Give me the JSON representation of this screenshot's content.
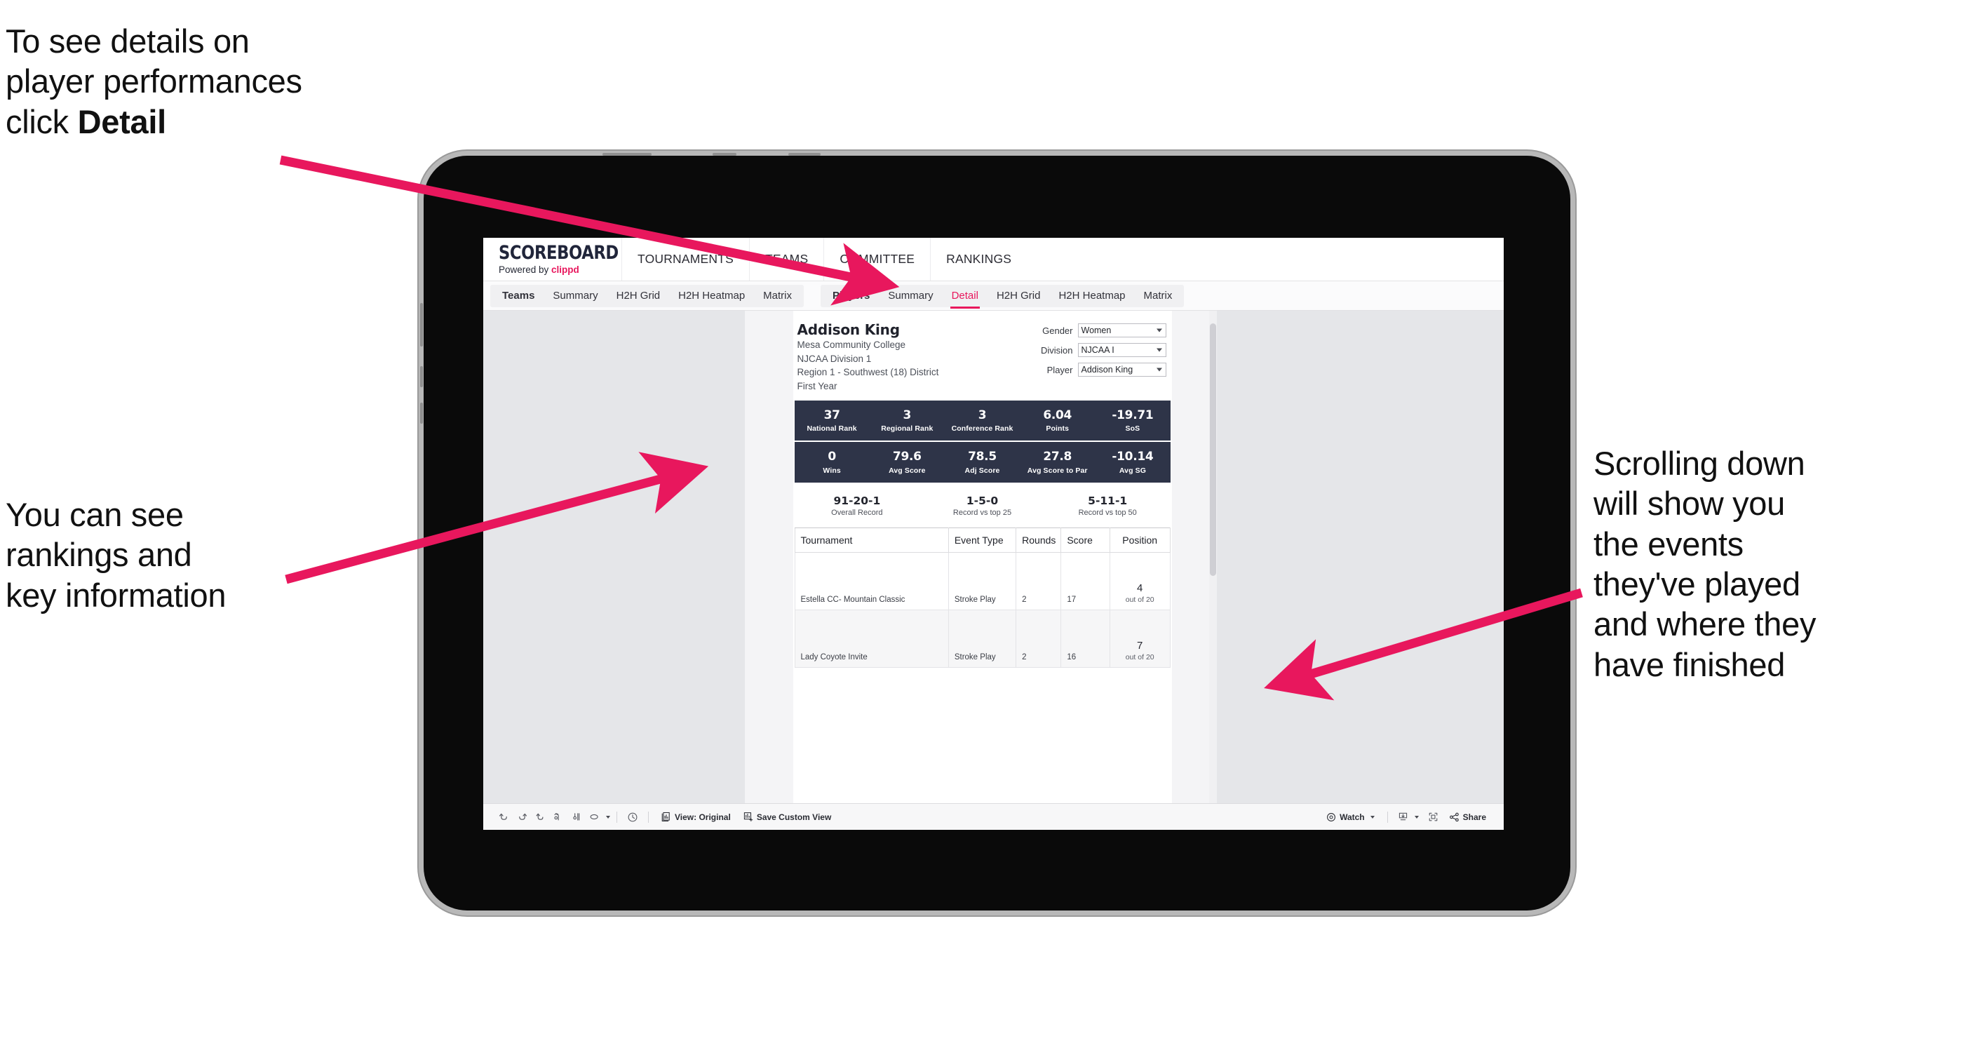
{
  "annotations": {
    "top_left": "To see details on\nplayer performances\nclick ",
    "top_left_bold": "Detail",
    "mid_left": "You can see\nrankings and\nkey information",
    "right": "Scrolling down\nwill show you\nthe events\nthey've played\nand where they\nhave finished"
  },
  "colors": {
    "accent_pink": "#e8175d",
    "band_navy": "#2e3448",
    "arrow_pink": "#e8175d"
  },
  "app": {
    "logo": {
      "title": "SCOREBOARD",
      "powered_prefix": "Powered by ",
      "brand": "clippd"
    },
    "top_nav": [
      "TOURNAMENTS",
      "TEAMS",
      "COMMITTEE",
      "RANKINGS"
    ],
    "tab_groups": [
      {
        "label": "Teams",
        "tabs": [
          "Summary",
          "H2H Grid",
          "H2H Heatmap",
          "Matrix"
        ],
        "active": null
      },
      {
        "label": "Players",
        "tabs": [
          "Summary",
          "Detail",
          "H2H Grid",
          "H2H Heatmap",
          "Matrix"
        ],
        "active": "Detail"
      }
    ]
  },
  "player": {
    "name": "Addison King",
    "school": "Mesa Community College",
    "division": "NJCAA Division 1",
    "region": "Region 1 - Southwest (18) District",
    "year": "First Year"
  },
  "filters": [
    {
      "label": "Gender",
      "value": "Women"
    },
    {
      "label": "Division",
      "value": "NJCAA I"
    },
    {
      "label": "Player",
      "value": "Addison King"
    }
  ],
  "stats_band_1": [
    {
      "value": "37",
      "label": "National Rank"
    },
    {
      "value": "3",
      "label": "Regional Rank"
    },
    {
      "value": "3",
      "label": "Conference Rank"
    },
    {
      "value": "6.04",
      "label": "Points"
    },
    {
      "value": "-19.71",
      "label": "SoS"
    }
  ],
  "stats_band_2": [
    {
      "value": "0",
      "label": "Wins"
    },
    {
      "value": "79.6",
      "label": "Avg Score"
    },
    {
      "value": "78.5",
      "label": "Adj Score"
    },
    {
      "value": "27.8",
      "label": "Avg Score to Par"
    },
    {
      "value": "-10.14",
      "label": "Avg SG"
    }
  ],
  "records": [
    {
      "value": "91-20-1",
      "label": "Overall Record"
    },
    {
      "value": "1-5-0",
      "label": "Record vs top 25"
    },
    {
      "value": "5-11-1",
      "label": "Record vs top 50"
    }
  ],
  "table": {
    "headers": [
      "Tournament",
      "Event Type",
      "Rounds",
      "Score",
      "Position"
    ],
    "rows": [
      {
        "tournament": "Estella CC- Mountain Classic",
        "event_type": "Stroke Play",
        "rounds": "2",
        "score": "17",
        "position": "4",
        "position_out_of": "out of 20"
      },
      {
        "tournament": "Lady Coyote Invite",
        "event_type": "Stroke Play",
        "rounds": "2",
        "score": "16",
        "position": "7",
        "position_out_of": "out of 20"
      }
    ]
  },
  "toolbar": {
    "view_label": "View: Original",
    "save_label": "Save Custom View",
    "watch_label": "Watch",
    "share_label": "Share"
  }
}
